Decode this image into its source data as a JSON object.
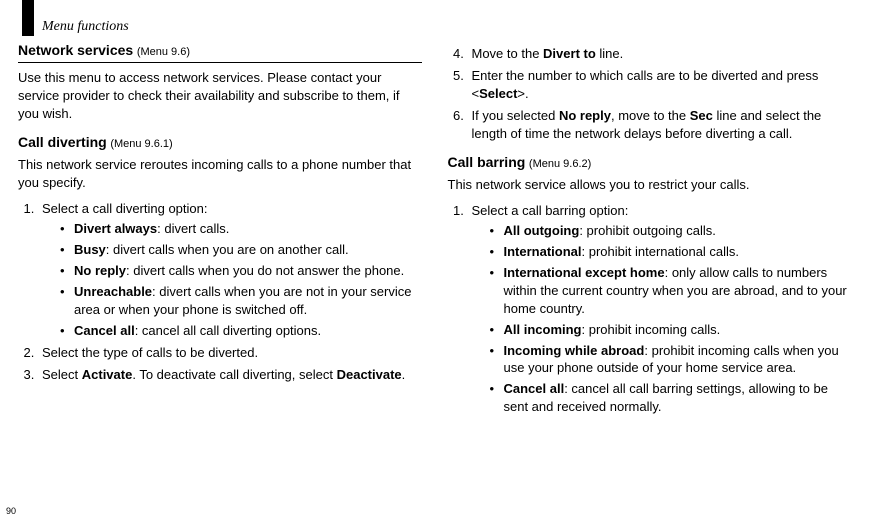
{
  "header": {
    "title": "Menu functions"
  },
  "page_number": "90",
  "left": {
    "section_title": "Network services",
    "section_menu": "(Menu 9.6)",
    "intro": "Use this menu to access network services. Please contact your service provider to check their availability and subscribe to them, if you wish.",
    "sub1_title": "Call diverting",
    "sub1_menu": "(Menu 9.6.1)",
    "sub1_intro": "This network service reroutes incoming calls to a phone number that you specify.",
    "step1_label": "Select a call diverting option:",
    "opts": [
      {
        "term": "Divert always",
        "desc": ": divert calls."
      },
      {
        "term": "Busy",
        "desc": ": divert calls when you are on another call."
      },
      {
        "term": "No reply",
        "desc": ": divert calls when you do not answer the phone."
      },
      {
        "term": "Unreachable",
        "desc": ": divert calls when you are not in your service area or when your phone is switched off."
      },
      {
        "term": "Cancel all",
        "desc": ": cancel all call diverting options."
      }
    ],
    "step2": "Select the type of calls to be diverted.",
    "step3_a": "Select ",
    "step3_b": "Activate",
    "step3_c": ". To deactivate call diverting, select ",
    "step3_d": "Deactivate",
    "step3_e": "."
  },
  "right": {
    "step4_a": "Move to the ",
    "step4_b": "Divert to",
    "step4_c": " line.",
    "step5_a": "Enter the number to which calls are to be diverted and press <",
    "step5_b": "Select",
    "step5_c": ">.",
    "step6_a": "If you selected ",
    "step6_b": "No reply",
    "step6_c": ", move to the ",
    "step6_d": "Sec",
    "step6_e": " line and select the length of time the network delays before diverting a call.",
    "sub2_title": "Call barring",
    "sub2_menu": "(Menu 9.6.2)",
    "sub2_intro": "This network service allows you to restrict your calls.",
    "step1_label": "Select a call barring option:",
    "opts": [
      {
        "term": "All outgoing",
        "desc": ": prohibit outgoing calls."
      },
      {
        "term": "International",
        "desc": ": prohibit international calls."
      },
      {
        "term": "International except home",
        "desc": ": only allow calls to numbers within the current country when you are abroad, and to your home country."
      },
      {
        "term": "All incoming",
        "desc": ": prohibit incoming calls."
      },
      {
        "term": "Incoming while abroad",
        "desc": ": prohibit incoming calls when you use your phone outside of your home service area."
      },
      {
        "term": "Cancel all",
        "desc": ": cancel all call barring settings, allowing to be sent and received normally."
      }
    ]
  }
}
